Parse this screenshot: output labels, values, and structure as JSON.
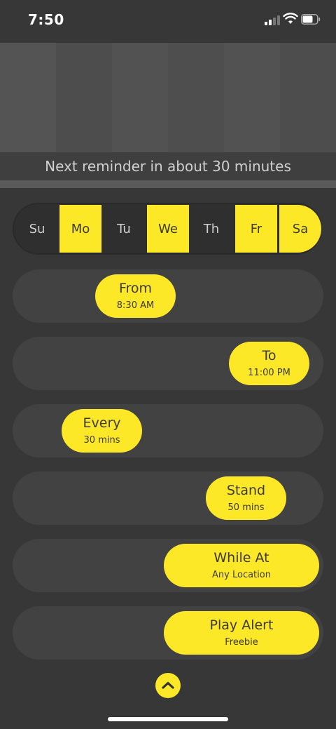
{
  "status": {
    "time": "7:50"
  },
  "hero": {
    "message": "Next reminder in about 30 minutes"
  },
  "days": [
    {
      "label": "Su",
      "active": false
    },
    {
      "label": "Mo",
      "active": true
    },
    {
      "label": "Tu",
      "active": false
    },
    {
      "label": "We",
      "active": true
    },
    {
      "label": "Th",
      "active": false
    },
    {
      "label": "Fr",
      "active": true
    },
    {
      "label": "Sa",
      "active": true
    }
  ],
  "settings": {
    "from": {
      "title": "From",
      "value": "8:30 AM"
    },
    "to": {
      "title": "To",
      "value": "11:00 PM"
    },
    "every": {
      "title": "Every",
      "value": "30 mins"
    },
    "stand": {
      "title": "Stand",
      "value": "50 mins"
    },
    "while_at": {
      "title": "While At",
      "value": "Any Location"
    },
    "play_alert": {
      "title": "Play Alert",
      "value": "Freebie"
    }
  },
  "colors": {
    "accent": "#fde827",
    "background": "#373737",
    "track": "#424242"
  },
  "icons": {
    "collapse": "chevron-up-icon"
  }
}
